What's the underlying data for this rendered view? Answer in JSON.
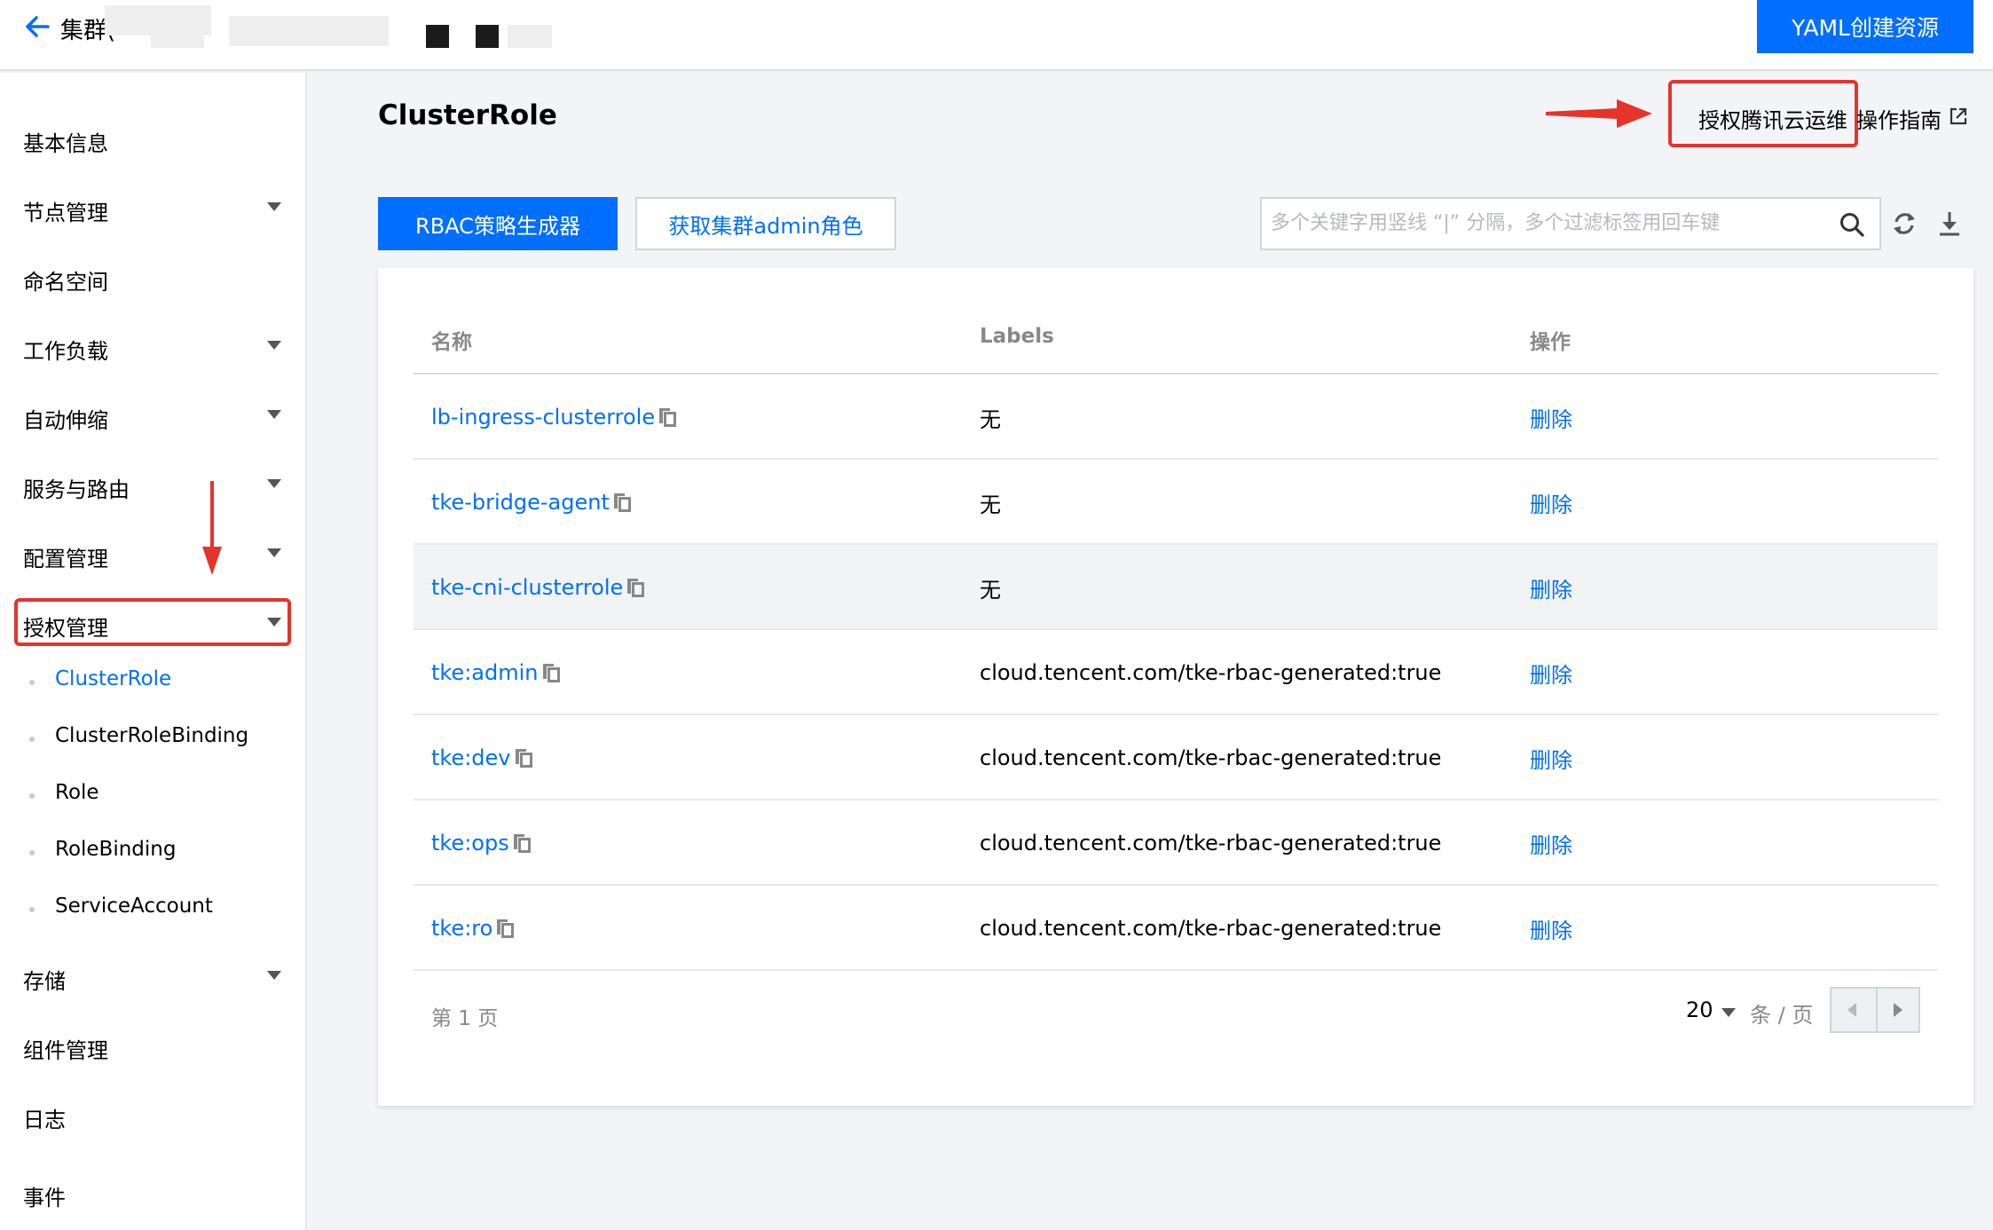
{
  "header": {
    "cluster_label": "集群(",
    "yaml_button": "YAML创建资源"
  },
  "sidebar": {
    "items": [
      {
        "label": "基本信息"
      },
      {
        "label": "节点管理"
      },
      {
        "label": "命名空间"
      },
      {
        "label": "工作负载"
      },
      {
        "label": "自动伸缩"
      },
      {
        "label": "服务与路由"
      },
      {
        "label": "配置管理"
      },
      {
        "label": "授权管理"
      },
      {
        "label": "存储"
      },
      {
        "label": "组件管理"
      },
      {
        "label": "日志"
      },
      {
        "label": "事件"
      }
    ],
    "sub_items": [
      {
        "label": "ClusterRole"
      },
      {
        "label": "ClusterRoleBinding"
      },
      {
        "label": "Role"
      },
      {
        "label": "RoleBinding"
      },
      {
        "label": "ServiceAccount"
      }
    ]
  },
  "main": {
    "title": "ClusterRole",
    "auth_link": "授权腾讯云运维",
    "guide_link": "操作指南",
    "rbac_button": "RBAC策略生成器",
    "admin_button": "获取集群admin角色",
    "search_placeholder": "多个关键字用竖线 “|” 分隔，多个过滤标签用回车键"
  },
  "table": {
    "headers": {
      "name": "名称",
      "labels": "Labels",
      "ops": "操作"
    },
    "rows": [
      {
        "name": "lb-ingress-clusterrole",
        "labels": "无",
        "op": "删除"
      },
      {
        "name": "tke-bridge-agent",
        "labels": "无",
        "op": "删除"
      },
      {
        "name": "tke-cni-clusterrole",
        "labels": "无",
        "op": "删除"
      },
      {
        "name": "tke:admin",
        "labels": "cloud.tencent.com/tke-rbac-generated:true",
        "op": "删除"
      },
      {
        "name": "tke:dev",
        "labels": "cloud.tencent.com/tke-rbac-generated:true",
        "op": "删除"
      },
      {
        "name": "tke:ops",
        "labels": "cloud.tencent.com/tke-rbac-generated:true",
        "op": "删除"
      },
      {
        "name": "tke:ro",
        "labels": "cloud.tencent.com/tke-rbac-generated:true",
        "op": "删除"
      }
    ]
  },
  "pagination": {
    "page_info": "第 1 页",
    "page_size": "20",
    "unit": "条 / 页"
  },
  "colors": {
    "accent": "#006eff",
    "annotation": "#e5342b"
  }
}
